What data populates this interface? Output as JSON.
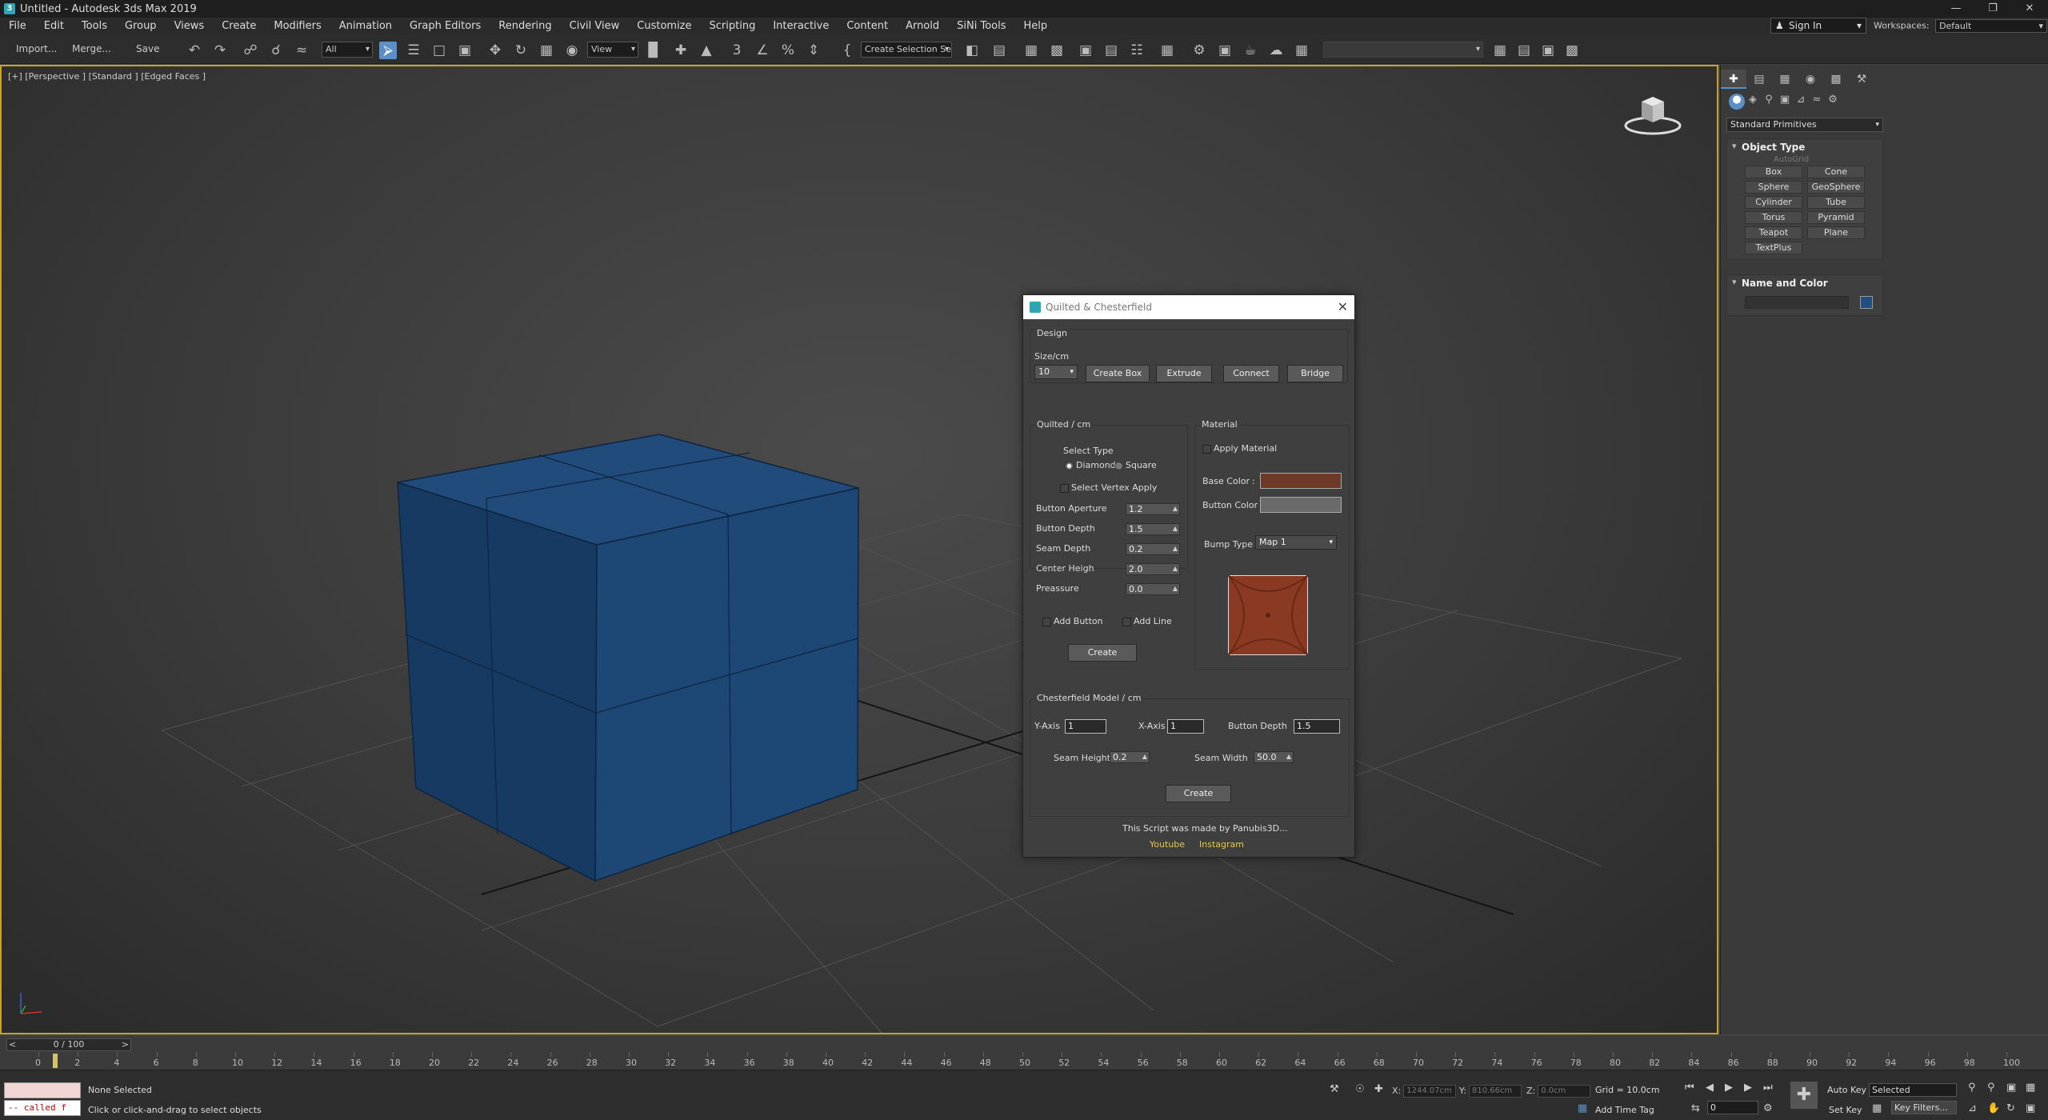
{
  "window": {
    "title": "Untitled - Autodesk 3ds Max 2019",
    "app_icon": "3"
  },
  "menu": [
    "File",
    "Edit",
    "Tools",
    "Group",
    "Views",
    "Create",
    "Modifiers",
    "Animation",
    "Graph Editors",
    "Rendering",
    "Civil View",
    "Customize",
    "Scripting",
    "Interactive",
    "Content",
    "Arnold",
    "SiNi Tools",
    "Help"
  ],
  "account": {
    "signin": "Sign In",
    "workspaces_label": "Workspaces:",
    "workspace": "Default"
  },
  "toolbar": {
    "import": "Import...",
    "merge": "Merge...",
    "save": "Save",
    "filter": "All",
    "ref_coord": "View",
    "selection_set": "Create Selection Se"
  },
  "viewport": {
    "label": "[+] [Perspective ] [Standard ] [Edged Faces ]",
    "cube_color": "#1f4a78"
  },
  "command_panel": {
    "category": "Standard Primitives",
    "object_type": "Object Type",
    "autogrid": "AutoGrid",
    "primitives": [
      "Box",
      "Cone",
      "Sphere",
      "GeoSphere",
      "Cylinder",
      "Tube",
      "Torus",
      "Pyramid",
      "Teapot",
      "Plane",
      "TextPlus"
    ],
    "name_color": "Name and Color",
    "object_color": "#234f80"
  },
  "timeline": {
    "slider": "0 / 100",
    "prev": "<",
    "next": ">",
    "ticks": [
      "0",
      "2",
      "4",
      "6",
      "8",
      "10",
      "12",
      "14",
      "16",
      "18",
      "20",
      "22",
      "24",
      "26",
      "28",
      "30",
      "32",
      "34",
      "36",
      "38",
      "40",
      "42",
      "44",
      "46",
      "48",
      "50",
      "52",
      "54",
      "56",
      "58",
      "60",
      "62",
      "64",
      "66",
      "68",
      "70",
      "72",
      "74",
      "76",
      "78",
      "80",
      "82",
      "84",
      "86",
      "88",
      "90",
      "92",
      "94",
      "96",
      "98",
      "100"
    ]
  },
  "status": {
    "maxscript_output": "-- called f",
    "selection": "None Selected",
    "prompt": "Click or click-and-drag to select objects",
    "x_label": "X:",
    "x_val": "1244.07cm",
    "y_label": "Y:",
    "y_val": "810.66cm",
    "z_label": "Z:",
    "z_val": "0.0cm",
    "grid": "Grid = 10.0cm",
    "add_time_tag": "Add Time Tag",
    "auto_key": "Auto Key",
    "set_key": "Set Key",
    "selected": "Selected",
    "key_filters": "Key Filters...",
    "frame": "0"
  },
  "dialog": {
    "title": "Quilted & Chesterfield",
    "design": {
      "group": "Design",
      "size_label": "Size/cm",
      "size_value": "10",
      "buttons": {
        "create_box": "Create Box",
        "extrude": "Extrude",
        "connect": "Connect",
        "bridge": "Bridge"
      }
    },
    "quilted": {
      "group": "Quilted / cm",
      "select_type": "Select Type",
      "diamond": "Diamond",
      "square": "Square",
      "select_vertex": "Select Vertex Apply",
      "params": [
        {
          "label": "Button Aperture",
          "value": "1.2"
        },
        {
          "label": "Button Depth",
          "value": "1.5"
        },
        {
          "label": "Seam Depth",
          "value": "0.2"
        },
        {
          "label": "Center Heigh",
          "value": "2.0"
        },
        {
          "label": "Preassure",
          "value": "0.0"
        }
      ],
      "add_button": "Add Button",
      "add_line": "Add Line",
      "create": "Create"
    },
    "material": {
      "group": "Material",
      "apply": "Apply Material",
      "base_color_label": "Base Color",
      "base_color": "#6e3a28",
      "button_color_label": "Button Color :",
      "button_color": "#6a6a6a",
      "bump_label": "Bump Type",
      "bump_value": "Map 1"
    },
    "chesterfield": {
      "group": "Chesterfield Model / cm",
      "y_axis_label": "Y-Axis",
      "y_axis": "1",
      "x_axis_label": "X-Axis",
      "x_axis": "1",
      "button_depth_label": "Button Depth",
      "button_depth": "1.5",
      "seam_height_label": "Seam Height",
      "seam_height": "0.2",
      "seam_width_label": "Seam Width",
      "seam_width": "50.0",
      "create": "Create"
    },
    "credit": "This Script was made by Panubis3D...",
    "youtube": "Youtube",
    "instagram": "Instagram"
  }
}
